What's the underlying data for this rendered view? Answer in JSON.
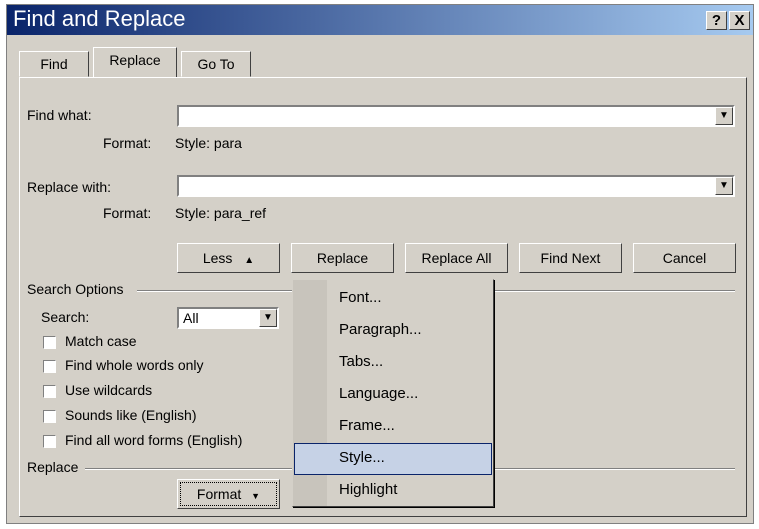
{
  "window": {
    "title": "Find and Replace",
    "help_button": "?",
    "close_button": "X"
  },
  "tabs": [
    {
      "label": "Find",
      "active": false
    },
    {
      "label": "Replace",
      "active": true
    },
    {
      "label": "Go To",
      "active": false
    }
  ],
  "find_what": {
    "label": "Find what:",
    "value": "",
    "format_label": "Format:",
    "format_value": "Style: para"
  },
  "replace_with": {
    "label": "Replace with:",
    "value": "",
    "format_label": "Format:",
    "format_value": "Style: para_ref"
  },
  "buttons": {
    "less": "Less",
    "replace": "Replace",
    "replace_all": "Replace All",
    "find_next": "Find Next",
    "cancel": "Cancel"
  },
  "search_options": {
    "heading": "Search Options",
    "search_label": "Search:",
    "search_value": "All",
    "checkboxes": [
      {
        "label": "Match case",
        "checked": false
      },
      {
        "label": "Find whole words only",
        "checked": false
      },
      {
        "label": "Use wildcards",
        "checked": false
      },
      {
        "label": "Sounds like (English)",
        "checked": false
      },
      {
        "label": "Find all word forms (English)",
        "checked": false
      }
    ]
  },
  "replace_section": {
    "heading": "Replace",
    "format_button": "Format"
  },
  "format_menu": {
    "items": [
      {
        "label": "Font...",
        "selected": false
      },
      {
        "label": "Paragraph...",
        "selected": false
      },
      {
        "label": "Tabs...",
        "selected": false
      },
      {
        "label": "Language...",
        "selected": false
      },
      {
        "label": "Frame...",
        "selected": false
      },
      {
        "label": "Style...",
        "selected": true
      },
      {
        "label": "Highlight",
        "selected": false
      }
    ]
  }
}
